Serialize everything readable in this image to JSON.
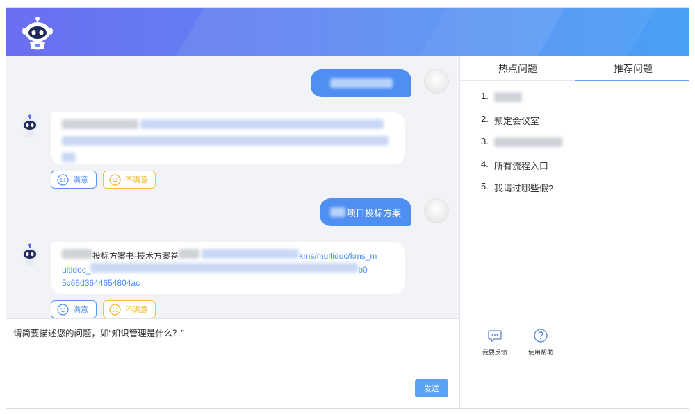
{
  "chat": {
    "messages": [
      {
        "role": "user",
        "text": "",
        "blurred": true
      },
      {
        "role": "bot",
        "blurred": true
      },
      {
        "role": "user",
        "text": "项目投标方案",
        "prefix_blurred": true
      },
      {
        "role": "bot",
        "line1_text": "投标方案书-技术方案卷",
        "line1_link_tail": "kms/multidoc/kms_m",
        "line2_text": "ultidoc_",
        "line2_tail": "b0",
        "line3_text": "5c66d3644654804ac"
      }
    ],
    "feedback": {
      "good_label": "满意",
      "bad_label": "不满意"
    }
  },
  "input": {
    "value": "请简要描述您的问题，如“知识管理是什么？”",
    "send_label": "发送"
  },
  "sidebar": {
    "tabs": [
      {
        "label": "热点问题",
        "active": false
      },
      {
        "label": "推荐问题",
        "active": true
      }
    ],
    "questions": [
      {
        "num": "1.",
        "text": "",
        "blurred": true
      },
      {
        "num": "2.",
        "text": "预定会议室"
      },
      {
        "num": "3.",
        "text": "",
        "blurred": true
      },
      {
        "num": "4.",
        "text": "所有流程入口"
      },
      {
        "num": "5.",
        "text": "我请过哪些假?"
      }
    ],
    "tools": [
      {
        "label": "我要反馈",
        "icon": "feedback-icon"
      },
      {
        "label": "使用帮助",
        "icon": "help-icon"
      }
    ]
  },
  "colors": {
    "accent": "#4f8ff2",
    "header_start": "#6b6ef0",
    "header_end": "#4aa0f6",
    "warn": "#f0b429"
  }
}
